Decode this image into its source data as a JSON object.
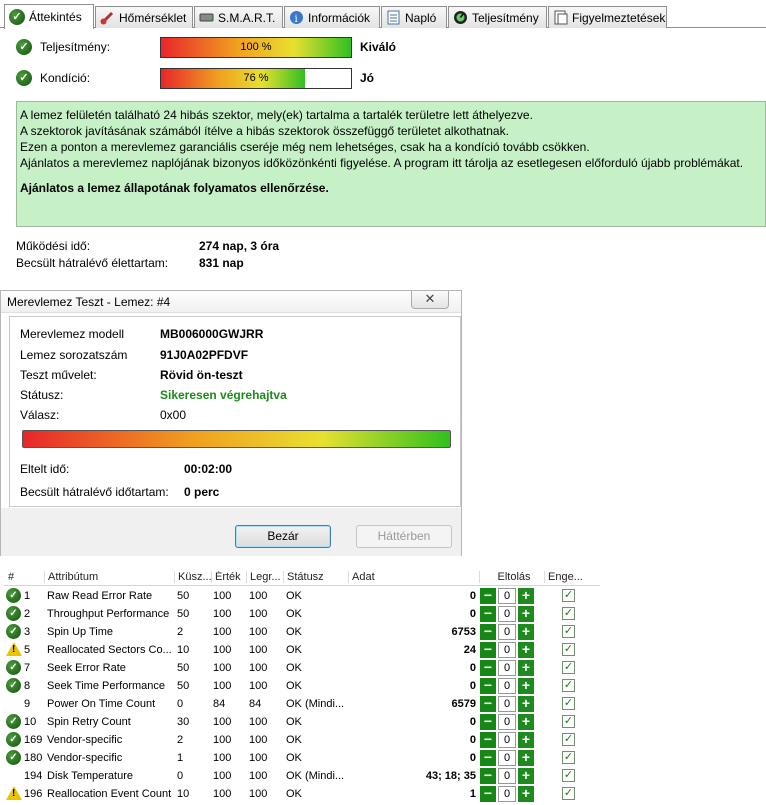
{
  "tabs": [
    {
      "label": "Áttekintés",
      "icon": "check-circle-icon"
    },
    {
      "label": "Hőmérséklet",
      "icon": "thermometer-icon"
    },
    {
      "label": "S.M.A.R.T.",
      "icon": "drive-icon"
    },
    {
      "label": "Információk",
      "icon": "info-icon"
    },
    {
      "label": "Napló",
      "icon": "log-icon"
    },
    {
      "label": "Teljesítmény",
      "icon": "performance-icon"
    },
    {
      "label": "Figyelmeztetések",
      "icon": "alerts-icon"
    }
  ],
  "overview": {
    "performance": {
      "label": "Teljesítmény:",
      "percent_text": "100 %",
      "percent": 100,
      "rating": "Kiváló"
    },
    "health": {
      "label": "Kondíció:",
      "percent_text": "76 %",
      "percent": 76,
      "rating": "Jó"
    },
    "message_lines": [
      "A lemez felületén található 24 hibás szektor, mely(ek) tartalma a tartalék területre lett áthelyezve.",
      "A szektorok javításának számából ítélve a hibás szektorok összefüggő területet alkothatnak.",
      "Ezen a ponton a merevlemez garanciális cseréje még nem lehetséges, csak ha a kondíció tovább csökken.",
      "Ajánlatos a merevlemez naplójának bizonyos időközönkénti figyelése. A program itt tárolja az esetlegesen előforduló újabb problémákat."
    ],
    "message_strong": "Ajánlatos a lemez állapotának folyamatos ellenőrzése.",
    "uptime_label": "Működési idő:",
    "uptime_value": "274 nap, 3 óra",
    "lifetime_label": "Becsült hátralévő élettartam:",
    "lifetime_value": "831 nap"
  },
  "dialog": {
    "title": "Merevlemez Teszt - Lemez: #4",
    "close_glyph": "✕",
    "model_label": "Merevlemez modell",
    "model_value": "MB006000GWJRR",
    "serial_label": "Lemez sorozatszám",
    "serial_value": "91J0A02PFDVF",
    "op_label": "Teszt művelet:",
    "op_value": "Rövid ön-teszt",
    "status_label": "Státusz:",
    "status_value": "Sikeresen végrehajtva",
    "response_label": "Válasz:",
    "response_value": "0x00",
    "progress": 100,
    "elapsed_label": "Eltelt idő:",
    "elapsed_value": "00:02:00",
    "remaining_label": "Becsült hátralévő időtartam:",
    "remaining_value": "0 perc",
    "close_button": "Bezár",
    "background_button": "Háttérben",
    "status_color": "#1d8a1d"
  },
  "smart": {
    "headers": [
      "#",
      "Attribútum",
      "Küsz...",
      "Érték",
      "Legr...",
      "Státusz",
      "Adat",
      "Eltolás",
      "Enge..."
    ],
    "rows": [
      {
        "icon": "ok",
        "id": "1",
        "name": "Raw Read Error Rate",
        "thr": "50",
        "val": "100",
        "worst": "100",
        "status": "OK",
        "data": "0",
        "offset": "0"
      },
      {
        "icon": "ok",
        "id": "2",
        "name": "Throughput Performance",
        "thr": "50",
        "val": "100",
        "worst": "100",
        "status": "OK",
        "data": "0",
        "offset": "0"
      },
      {
        "icon": "ok",
        "id": "3",
        "name": "Spin Up Time",
        "thr": "2",
        "val": "100",
        "worst": "100",
        "status": "OK",
        "data": "6753",
        "offset": "0"
      },
      {
        "icon": "warn",
        "id": "5",
        "name": "Reallocated Sectors Co...",
        "thr": "10",
        "val": "100",
        "worst": "100",
        "status": "OK",
        "data": "24",
        "offset": "0"
      },
      {
        "icon": "ok",
        "id": "7",
        "name": "Seek Error Rate",
        "thr": "50",
        "val": "100",
        "worst": "100",
        "status": "OK",
        "data": "0",
        "offset": "0"
      },
      {
        "icon": "ok",
        "id": "8",
        "name": "Seek Time Performance",
        "thr": "50",
        "val": "100",
        "worst": "100",
        "status": "OK",
        "data": "0",
        "offset": "0"
      },
      {
        "icon": "none",
        "id": "9",
        "name": "Power On Time Count",
        "thr": "0",
        "val": "84",
        "worst": "84",
        "status": "OK (Mindi...",
        "data": "6579",
        "offset": "0"
      },
      {
        "icon": "ok",
        "id": "10",
        "name": "Spin Retry Count",
        "thr": "30",
        "val": "100",
        "worst": "100",
        "status": "OK",
        "data": "0",
        "offset": "0"
      },
      {
        "icon": "ok",
        "id": "169",
        "name": "Vendor-specific",
        "thr": "2",
        "val": "100",
        "worst": "100",
        "status": "OK",
        "data": "0",
        "offset": "0"
      },
      {
        "icon": "ok",
        "id": "180",
        "name": "Vendor-specific",
        "thr": "1",
        "val": "100",
        "worst": "100",
        "status": "OK",
        "data": "0",
        "offset": "0"
      },
      {
        "icon": "none",
        "id": "194",
        "name": "Disk Temperature",
        "thr": "0",
        "val": "100",
        "worst": "100",
        "status": "OK (Mindi...",
        "data": "43; 18; 35",
        "offset": "0"
      },
      {
        "icon": "warn",
        "id": "196",
        "name": "Reallocation Event Count",
        "thr": "10",
        "val": "100",
        "worst": "100",
        "status": "OK",
        "data": "1",
        "offset": "0"
      }
    ]
  },
  "colors": {
    "message_bg": "#c6f1c6",
    "ok_green": "#1d8a1d"
  }
}
